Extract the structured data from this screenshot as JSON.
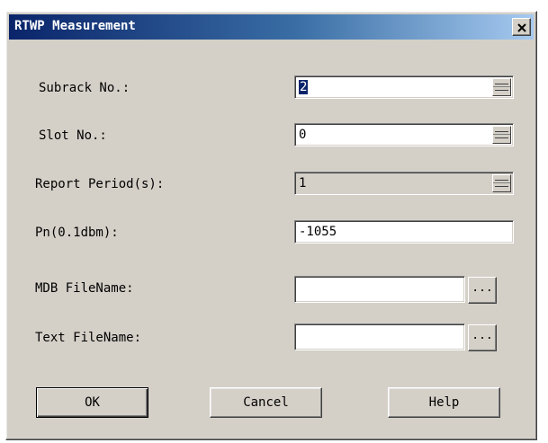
{
  "window": {
    "title": "RTWP Measurement",
    "close_icon": "close-icon"
  },
  "form": {
    "subrack": {
      "label": "Subrack No.:",
      "value": "2"
    },
    "slot": {
      "label": "Slot No.:",
      "value": "0"
    },
    "period": {
      "label": "Report Period(s):",
      "value": "1"
    },
    "pn": {
      "label": "Pn(0.1dbm):",
      "value": "-1055"
    },
    "mdb": {
      "label": "MDB FileName:",
      "value": "",
      "browse_label": "..."
    },
    "text": {
      "label": "Text FileName:",
      "value": "",
      "browse_label": "..."
    }
  },
  "buttons": {
    "ok": "OK",
    "cancel": "Cancel",
    "help": "Help"
  },
  "colors": {
    "titlebar_start": "#0a246a",
    "titlebar_end": "#a6caf0",
    "face": "#d4d0c8"
  }
}
